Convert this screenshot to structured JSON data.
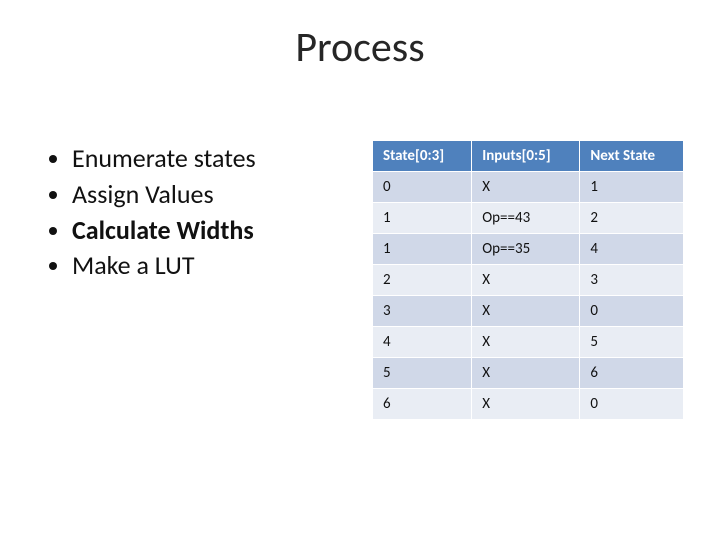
{
  "title": "Process",
  "bullets": [
    {
      "text": "Enumerate states",
      "bold": false
    },
    {
      "text": "Assign Values",
      "bold": false
    },
    {
      "text": "Calculate Widths",
      "bold": true
    },
    {
      "text": "Make a LUT",
      "bold": false
    }
  ],
  "table": {
    "headers": [
      "State[0:3]",
      "Inputs[0:5]",
      "Next State"
    ],
    "rows": [
      [
        "0",
        "X",
        "1"
      ],
      [
        "1",
        "Op==43",
        "2"
      ],
      [
        "1",
        "Op==35",
        "4"
      ],
      [
        "2",
        "X",
        "3"
      ],
      [
        "3",
        "X",
        "0"
      ],
      [
        "4",
        "X",
        "5"
      ],
      [
        "5",
        "X",
        "6"
      ],
      [
        "6",
        "X",
        "0"
      ]
    ]
  }
}
